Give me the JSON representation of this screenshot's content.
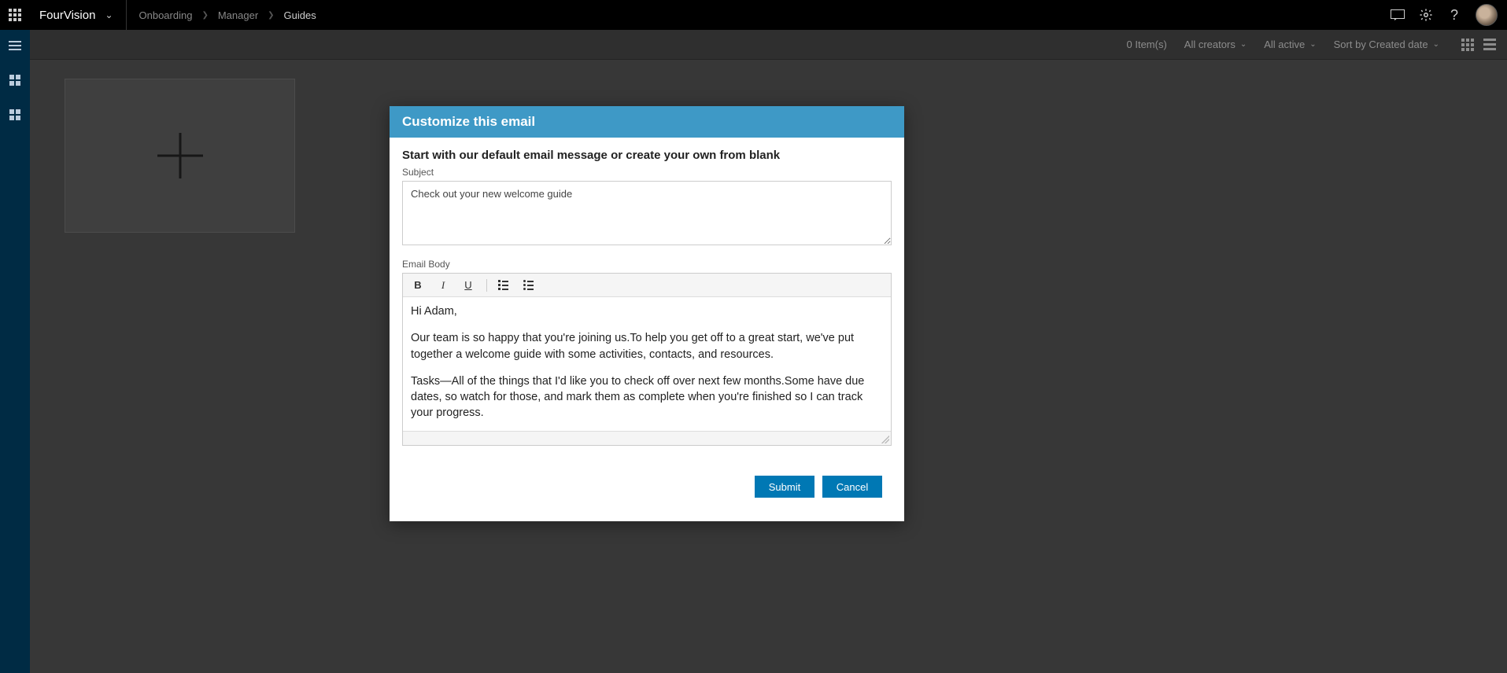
{
  "topbar": {
    "appname": "FourVision",
    "breadcrumbs": [
      "Onboarding",
      "Manager",
      "Guides"
    ]
  },
  "filterbar": {
    "items_count": "0 Item(s)",
    "creators": "All creators",
    "status": "All active",
    "sort": "Sort by Created date"
  },
  "modal": {
    "title": "Customize this email",
    "prompt": "Start with our default email message or create your own from blank",
    "subject_label": "Subject",
    "subject_value": "Check out your new welcome guide",
    "body_label": "Email Body",
    "body_paragraphs": [
      "Hi Adam,",
      "Our team is so happy that you're joining us.To help you get off to a great start, we've put together a welcome guide with some activities, contacts, and resources.",
      "Tasks—All of the things that I'd like you to check off over next few months.Some have due dates, so watch for those, and mark them as complete when you're finished so I can track your progress."
    ],
    "submit": "Submit",
    "cancel": "Cancel"
  }
}
